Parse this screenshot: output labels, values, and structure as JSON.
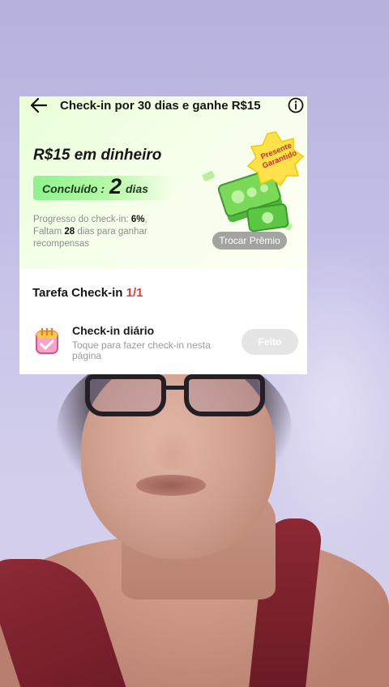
{
  "header": {
    "title": "Check-in por 30 dias e ganhe R$15"
  },
  "hero": {
    "cash_title": "R$15 em dinheiro",
    "done_label": "Concluído :",
    "done_days": "2",
    "done_unit": "dias",
    "progress_label": "Progresso do check-in:",
    "progress_percent": "6%",
    "progress_suffix": ",",
    "remaining_prefix": "Faltam",
    "remaining_days": "28",
    "remaining_suffix": "dias para ganhar recompensas",
    "badge_text": "Presente Garantido",
    "swap_button": "Trocar Prêmio"
  },
  "task": {
    "title": "Tarefa Check-in",
    "count": "1/1",
    "daily_title": "Check-in diário",
    "daily_sub": "Toque para fazer check-in nesta página",
    "done_button": "Feito"
  },
  "icons": {
    "back": "back-arrow-icon",
    "info": "info-icon",
    "calendar": "calendar-check-icon",
    "money": "money-stack-icon",
    "badge": "star-badge-icon"
  },
  "colors": {
    "accent_green": "#8ef28e",
    "count_red": "#e53935",
    "badge_yellow": "#ffe24a"
  }
}
